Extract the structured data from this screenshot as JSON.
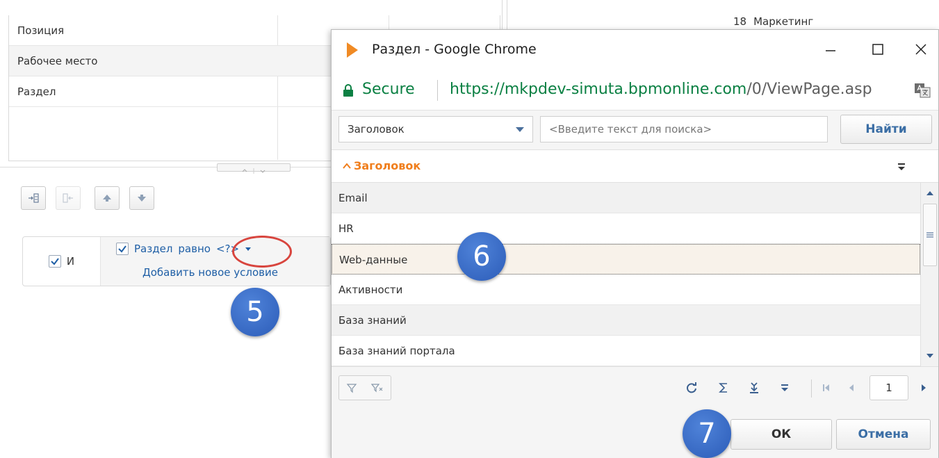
{
  "background": {
    "rows": [
      "Позиция",
      "Рабочее место",
      "Раздел"
    ],
    "top_right_number": "18",
    "top_right_label": "Маркетинг",
    "filter": {
      "group_label": "И",
      "condition_field": "Раздел",
      "condition_operator": "равно",
      "condition_value": "<?>",
      "add_condition": "Добавить новое условие"
    }
  },
  "annotations": {
    "badge_5": "5",
    "badge_6": "6",
    "badge_7": "7"
  },
  "window": {
    "title": "Раздел - Google Chrome",
    "secure_label": "Secure",
    "url_host": "https://mkpdev-simuta.bpmonline.com",
    "url_path": "/0/ViewPage.asp"
  },
  "search": {
    "column": "Заголовок",
    "placeholder": "<Введите текст для поиска>",
    "find_label": "Найти"
  },
  "grid": {
    "column_header": "Заголовок",
    "rows": [
      "Email",
      "HR",
      "Web-данные",
      "Активности",
      "База знаний",
      "База знаний портала"
    ],
    "selected_index": 2
  },
  "pager": {
    "page": "1"
  },
  "footer": {
    "ok_label": "ОК",
    "cancel_label": "Отмена"
  },
  "colors": {
    "accent_orange": "#f07e1c",
    "secure_green": "#0b8043",
    "link_blue": "#1f5fa6",
    "badge_blue": "#2c5cb8",
    "highlight_red": "#d8453e"
  }
}
